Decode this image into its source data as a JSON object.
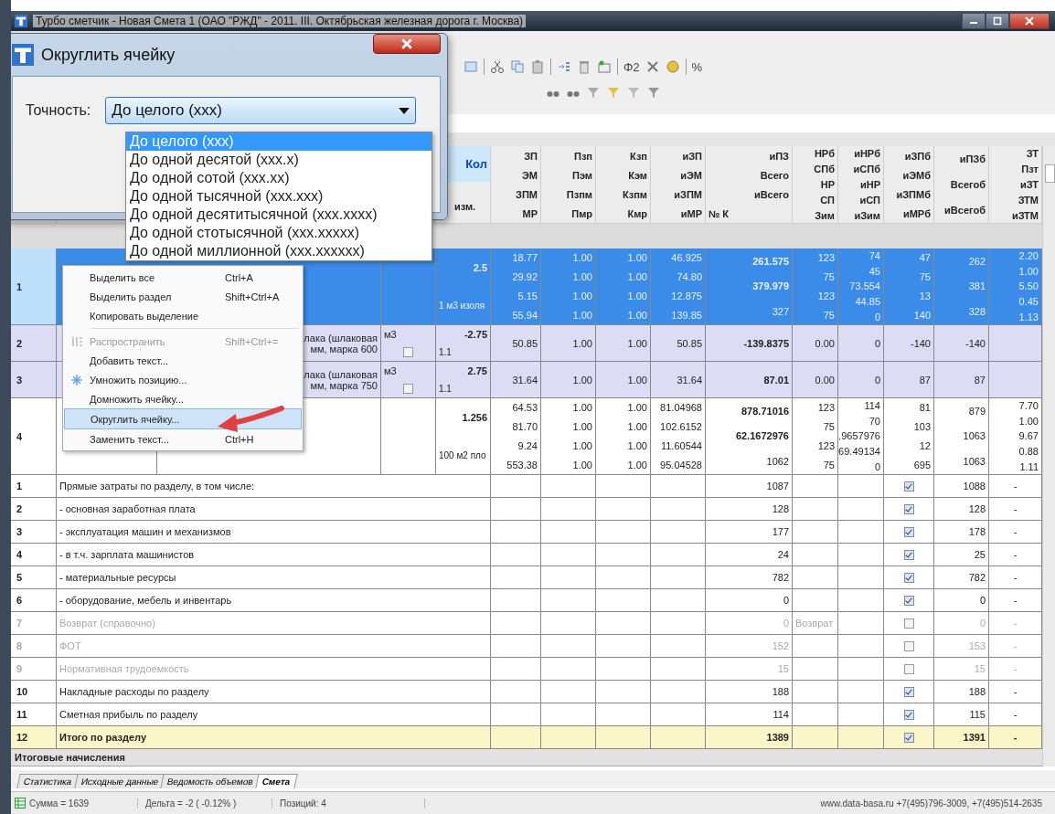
{
  "window": {
    "title": "Турбо сметчик - Новая Смета 1 (ОАО \"РЖД\" - 2011. III. Октябрьская железная дорога г. Москва)"
  },
  "toolbar": {
    "text_buttons": [
      "Φ2",
      "%"
    ]
  },
  "grid": {
    "header": {
      "quantity": "Кол",
      "unit": "изм.",
      "columns": [
        [
          "ЗП",
          "ЭМ",
          "ЗПМ",
          "МР"
        ],
        [
          "Пзп",
          "Пэм",
          "Пзпм",
          "Пмр"
        ],
        [
          "Кзп",
          "Кэм",
          "Кзпм",
          "Кмр"
        ],
        [
          "иЗП",
          "иЭМ",
          "иЗПМ",
          "иМР"
        ],
        [
          "иПЗ",
          "Всего",
          "иВсего",
          "№ К"
        ],
        [
          "НРб",
          "СПб",
          "НР",
          "СП",
          "Зим"
        ],
        [
          "иНРб",
          "иСПб",
          "иНР",
          "иСП",
          "иЗим"
        ],
        [
          "иЗПб",
          "иЭМб",
          "иЗПМб",
          "иМРб"
        ],
        [
          "иПЗб",
          "Всегоб",
          "иВсегоб"
        ],
        [
          "ЗТ",
          "Пзт",
          "иЗТ",
          "ЗТМ",
          "иЗТМ"
        ]
      ]
    },
    "positions": [
      {
        "number": "1",
        "selected": true,
        "kind": "work",
        "quantity": [
          "2.5",
          "1 м3 изоля"
        ],
        "cells": [
          [
            "18.77",
            "29.92",
            "5.15",
            "55.94"
          ],
          [
            "1.00",
            "1.00",
            "1.00",
            "1.00"
          ],
          [
            "1.00",
            "1.00",
            "1.00",
            "1.00"
          ],
          [
            "46.925",
            "74.80",
            "12.875",
            "139.85"
          ],
          [
            "261.575",
            "379.979",
            "327"
          ],
          [
            "123",
            "75",
            "123",
            "75"
          ],
          [
            "74",
            "45",
            "73.554",
            "44.85",
            "0"
          ],
          [
            "47",
            "75",
            "13",
            "140"
          ],
          [
            "262",
            "381",
            "328"
          ],
          [
            "2.20",
            "1.00",
            "5.50",
            "0.45",
            "1.13"
          ]
        ]
      },
      {
        "number": "2",
        "selected": false,
        "kind": "material",
        "description": [
          "лака (шлаковая",
          "мм, марка 600"
        ],
        "unit": {
          "text": "м3",
          "checked": false
        },
        "quantity": [
          "-2.75",
          "1.1"
        ],
        "cells": [
          [
            "50.85"
          ],
          [
            "1.00"
          ],
          [
            "1.00"
          ],
          [
            "50.85"
          ],
          [
            "-139.8375"
          ],
          [
            "0.00"
          ],
          [
            "0"
          ],
          [
            "-140"
          ],
          [
            "-140"
          ],
          []
        ]
      },
      {
        "number": "3",
        "selected": false,
        "kind": "material",
        "description": [
          "лака (шлаковая",
          "мм, марка 750"
        ],
        "unit": {
          "text": "м3",
          "checked": false
        },
        "quantity": [
          "2.75",
          "1.1"
        ],
        "cells": [
          [
            "31.64"
          ],
          [
            "1.00"
          ],
          [
            "1.00"
          ],
          [
            "31.64"
          ],
          [
            "87.01"
          ],
          [
            "0.00"
          ],
          [
            "0"
          ],
          [
            "87"
          ],
          [
            "87"
          ],
          []
        ]
      },
      {
        "number": "4",
        "selected": false,
        "kind": "work",
        "quantity": [
          "1.256",
          "100 м2 пло"
        ],
        "cells": [
          [
            "64.53",
            "81.70",
            "9.24",
            "553.38"
          ],
          [
            "1.00",
            "1.00",
            "1.00",
            "1.00"
          ],
          [
            "1.00",
            "1.00",
            "1.00",
            "1.00"
          ],
          [
            "81.04968",
            "102.6152",
            "11.60544",
            "95.04528"
          ],
          [
            "878.71016",
            "62.1672976",
            "1062"
          ],
          [
            "123",
            "75",
            "123",
            "75"
          ],
          [
            "114",
            "70",
            ".9657976",
            "69.49134",
            "0"
          ],
          [
            "81",
            "103",
            "12",
            "695"
          ],
          [
            "879",
            "1063",
            "1063"
          ],
          [
            "7.70",
            "1.00",
            "9.67",
            "0.88",
            "1.11"
          ]
        ]
      }
    ],
    "summary": [
      {
        "number": "1",
        "label": "Прямые затраты по разделу, в том числе:",
        "total": "1087",
        "checked": true,
        "final": "1088",
        "dash": "-",
        "disabled": false,
        "kind": "line"
      },
      {
        "number": "2",
        "label": "- основная заработная плата",
        "total": "128",
        "checked": true,
        "final": "128",
        "dash": "-",
        "disabled": false,
        "kind": "line"
      },
      {
        "number": "3",
        "label": "- эксплуатация машин и механизмов",
        "total": "177",
        "checked": true,
        "final": "178",
        "dash": "-",
        "disabled": false,
        "kind": "line"
      },
      {
        "number": "4",
        "label": "- в т.ч. зарплата машинистов",
        "total": "24",
        "checked": true,
        "final": "25",
        "dash": "-",
        "disabled": false,
        "kind": "line"
      },
      {
        "number": "5",
        "label": "- материальные ресурсы",
        "total": "782",
        "checked": true,
        "final": "782",
        "dash": "-",
        "disabled": false,
        "kind": "line"
      },
      {
        "number": "6",
        "label": "- оборудование, мебель и инвентарь",
        "total": "0",
        "checked": true,
        "final": "0",
        "dash": "-",
        "disabled": false,
        "kind": "line"
      },
      {
        "number": "7",
        "label": "Возврат (справочно)",
        "total": "0",
        "note": "Возврат",
        "checked": false,
        "final": "0",
        "dash": "-",
        "disabled": true,
        "kind": "line"
      },
      {
        "number": "8",
        "label": "ФОТ",
        "total": "152",
        "checked": false,
        "final": "153",
        "dash": "-",
        "disabled": true,
        "kind": "line"
      },
      {
        "number": "9",
        "label": "Нормативная трудоемкость",
        "total": "15",
        "checked": false,
        "final": "15",
        "dash": "-",
        "disabled": true,
        "kind": "line"
      },
      {
        "number": "10",
        "label": "Накладные расходы по разделу",
        "total": "188",
        "checked": true,
        "final": "188",
        "dash": "-",
        "disabled": false,
        "kind": "line"
      },
      {
        "number": "11",
        "label": "Сметная прибыль по разделу",
        "total": "114",
        "checked": true,
        "final": "115",
        "dash": "-",
        "disabled": false,
        "kind": "line"
      },
      {
        "number": "12",
        "label": "Итого по разделу",
        "total": "1389",
        "checked": true,
        "final": "1391",
        "dash": "-",
        "disabled": false,
        "kind": "total"
      }
    ],
    "footer_row": "Итоговые начисления"
  },
  "sheet_tabs": [
    {
      "label": "Статистика",
      "selected": false
    },
    {
      "label": "Исходные данные",
      "selected": false
    },
    {
      "label": "Ведомость объемов",
      "selected": false
    },
    {
      "label": "Смета",
      "selected": true
    }
  ],
  "status_bar": {
    "items": [
      "Сумма = 1639",
      "Дельта = -2 ( -0.12% )",
      "Позиций: 4"
    ],
    "contacts": "www.data-basa.ru  +7(495)796-3009, +7(495)514-2635"
  },
  "context_menu": {
    "items": [
      {
        "kind": "item",
        "label": "Выделить все",
        "shortcut": "Ctrl+A",
        "disabled": false,
        "selected": false
      },
      {
        "kind": "item",
        "label": "Выделить раздел",
        "shortcut": "Shift+Ctrl+A",
        "disabled": false,
        "selected": false
      },
      {
        "kind": "item",
        "label": "Копировать выделение",
        "disabled": false,
        "selected": false
      },
      {
        "kind": "separator"
      },
      {
        "kind": "grip",
        "label": "Распространить",
        "shortcut": "Shift+Ctrl+=",
        "disabled": true,
        "selected": false
      },
      {
        "kind": "item",
        "label": "Добавить текст...",
        "disabled": false,
        "selected": false
      },
      {
        "kind": "star",
        "label": "Умножить позицию...",
        "disabled": false,
        "selected": false
      },
      {
        "kind": "item",
        "label": "Домножить ячейку...",
        "disabled": false,
        "selected": false
      },
      {
        "kind": "item",
        "label": "Округлить ячейку...",
        "disabled": false,
        "selected": true
      },
      {
        "kind": "item",
        "label": "Заменить текст...",
        "shortcut": "Ctrl+H",
        "disabled": false,
        "selected": false
      }
    ]
  },
  "dialog": {
    "title": "Округлить ячейку",
    "label": "Точность:",
    "value": "До целого (xxx)",
    "options": [
      {
        "label": "До целого (xxx)",
        "selected": true
      },
      {
        "label": "До одной десятой (xxx.x)",
        "selected": false
      },
      {
        "label": "До одной сотой (xxx.xx)",
        "selected": false
      },
      {
        "label": "До одной тысячной (xxx.xxx)",
        "selected": false
      },
      {
        "label": "До одной десятитысячной (xxx.xxxx)",
        "selected": false
      },
      {
        "label": "До одной стотысячной (xxx.xxxxx)",
        "selected": false
      },
      {
        "label": "До одной миллионной (xxx.xxxxxx)",
        "selected": false
      }
    ]
  }
}
